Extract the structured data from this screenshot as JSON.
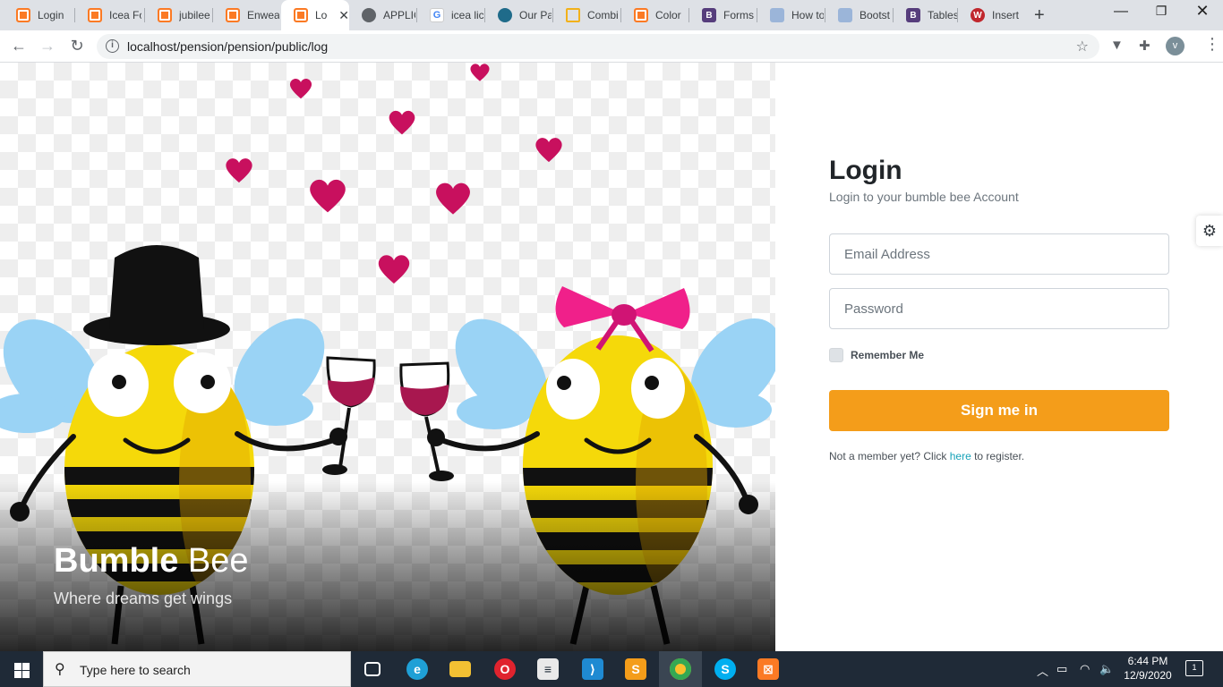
{
  "browser": {
    "tabs": [
      {
        "title": "Login",
        "icon": "xampp-icon",
        "active": false
      },
      {
        "title": "Icea Fo",
        "icon": "xampp-icon",
        "active": false
      },
      {
        "title": "jubilee",
        "icon": "xampp-icon",
        "active": false
      },
      {
        "title": "Enweal",
        "icon": "xampp-icon",
        "active": false
      },
      {
        "title": "Log",
        "icon": "xampp-icon",
        "active": true
      },
      {
        "title": "APPLIC",
        "icon": "globe-icon",
        "active": false
      },
      {
        "title": "icea lic",
        "icon": "google-icon",
        "active": false
      },
      {
        "title": "Our Pa",
        "icon": "site-icon",
        "active": false
      },
      {
        "title": "Combi",
        "icon": "combine-icon",
        "active": false
      },
      {
        "title": "Color",
        "icon": "xampp-icon",
        "active": false
      },
      {
        "title": "Forms",
        "icon": "bootstrap-icon",
        "active": false
      },
      {
        "title": "How to",
        "icon": "checker-icon",
        "active": false
      },
      {
        "title": "Bootst",
        "icon": "checker-icon",
        "active": false
      },
      {
        "title": "Tables",
        "icon": "bootstrap-icon",
        "active": false
      },
      {
        "title": "Insert",
        "icon": "w-icon",
        "active": false
      }
    ],
    "url": "localhost/pension/pension/public/log",
    "profile_initial": "v"
  },
  "hero": {
    "brand_bold": "Bumble",
    "brand_light": "Bee",
    "tagline": "Where dreams get wings"
  },
  "login": {
    "title": "Login",
    "subtitle": "Login to your bumble bee Account",
    "email_placeholder": "Email Address",
    "password_placeholder": "Password",
    "remember_label": "Remember Me",
    "submit_label": "Sign me in",
    "register_prefix": "Not a member yet? Click",
    "register_link": "here",
    "register_suffix": "to register."
  },
  "taskbar": {
    "search_placeholder": "Type here to search",
    "time": "6:44 PM",
    "date": "12/9/2020",
    "notification_count": "1"
  },
  "colors": {
    "accent_button": "#f49d1a",
    "link": "#17a2b8",
    "bee_yellow": "#f5d90a",
    "bee_wing": "#9ad3f5",
    "heart": "#c8105e",
    "bow": "#f0208a"
  }
}
